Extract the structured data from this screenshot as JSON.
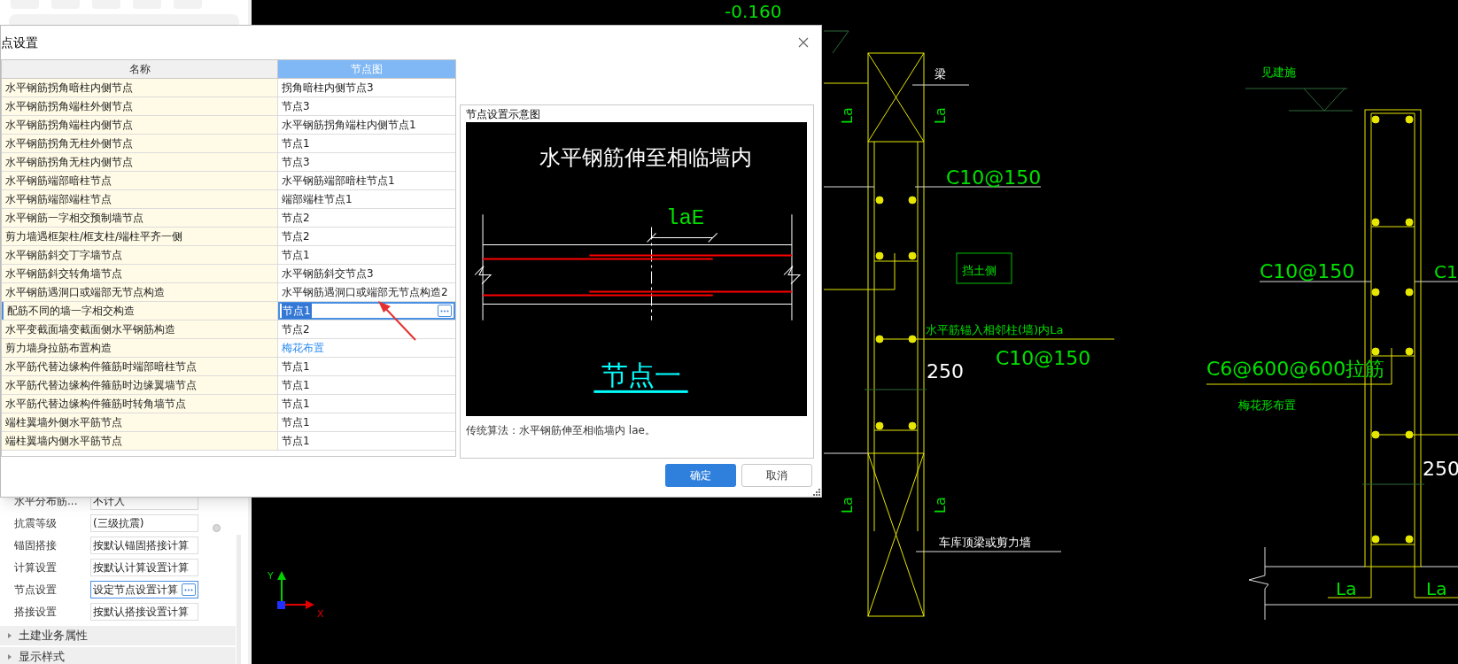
{
  "sidebar": {
    "properties": [
      {
        "label": "水平分布筋...",
        "value": "不计入",
        "kind": "text"
      },
      {
        "label": "抗震等级",
        "value": "(三级抗震)",
        "kind": "text"
      },
      {
        "label": "锚固搭接",
        "value": "按默认锚固搭接计算",
        "kind": "text"
      },
      {
        "label": "计算设置",
        "value": "按默认计算设置计算",
        "kind": "text"
      },
      {
        "label": "节点设置",
        "value": "设定节点设置计算",
        "kind": "ellipsis"
      },
      {
        "label": "搭接设置",
        "value": "按默认搭接设置计算",
        "kind": "text"
      }
    ],
    "groups": [
      {
        "label": "土建业务属性",
        "expanded": false
      },
      {
        "label": "显示样式",
        "expanded": false
      }
    ]
  },
  "dialog": {
    "title": "点设置",
    "columns": [
      "名称",
      "节点图"
    ],
    "rows": [
      {
        "name": "水平钢筋拐角暗柱内侧节点",
        "value": "拐角暗柱内侧节点3",
        "kind": "text",
        "selected": false
      },
      {
        "name": "水平钢筋拐角端柱外侧节点",
        "value": "节点3",
        "kind": "text",
        "selected": false
      },
      {
        "name": "水平钢筋拐角端柱内侧节点",
        "value": "水平钢筋拐角端柱内侧节点1",
        "kind": "text",
        "selected": false
      },
      {
        "name": "水平钢筋拐角无柱外侧节点",
        "value": "节点1",
        "kind": "text",
        "selected": false
      },
      {
        "name": "水平钢筋拐角无柱内侧节点",
        "value": "节点3",
        "kind": "text",
        "selected": false
      },
      {
        "name": "水平钢筋端部暗柱节点",
        "value": "水平钢筋端部暗柱节点1",
        "kind": "text",
        "selected": false
      },
      {
        "name": "水平钢筋端部端柱节点",
        "value": "端部端柱节点1",
        "kind": "text",
        "selected": false
      },
      {
        "name": "水平钢筋一字相交预制墙节点",
        "value": "节点2",
        "kind": "text",
        "selected": false
      },
      {
        "name": "剪力墙遇框架柱/框支柱/端柱平齐一侧",
        "value": "节点2",
        "kind": "text",
        "selected": false
      },
      {
        "name": "水平钢筋斜交丁字墙节点",
        "value": "节点1",
        "kind": "text",
        "selected": false
      },
      {
        "name": "水平钢筋斜交转角墙节点",
        "value": "水平钢筋斜交节点3",
        "kind": "text",
        "selected": false
      },
      {
        "name": "水平钢筋遇洞口或端部无节点构造",
        "value": "水平钢筋遇洞口或端部无节点构造2",
        "kind": "text",
        "selected": false
      },
      {
        "name": "配筋不同的墙一字相交构造",
        "value": "节点1",
        "kind": "text",
        "selected": true
      },
      {
        "name": "水平变截面墙变截面侧水平钢筋构造",
        "value": "节点2",
        "kind": "text",
        "selected": false
      },
      {
        "name": "剪力墙身拉筋布置构造",
        "value": "梅花布置",
        "kind": "link",
        "selected": false
      },
      {
        "name": "水平筋代替边缘构件箍筋时端部暗柱节点",
        "value": "节点1",
        "kind": "text",
        "selected": false
      },
      {
        "name": "水平筋代替边缘构件箍筋时边缘翼墙节点",
        "value": "节点1",
        "kind": "text",
        "selected": false
      },
      {
        "name": "水平筋代替边缘构件箍筋时转角墙节点",
        "value": "节点1",
        "kind": "text",
        "selected": false
      },
      {
        "name": "端柱翼墙外侧水平筋节点",
        "value": "节点1",
        "kind": "text",
        "selected": false
      },
      {
        "name": "端柱翼墙内侧水平筋节点",
        "value": "节点1",
        "kind": "text",
        "selected": false
      }
    ],
    "preview": {
      "title": "节点设置示意图",
      "heading": "水平钢筋伸至相临墙内",
      "dimension": "laE",
      "caption": "节点一",
      "description": "传统算法：水平钢筋伸至相临墙内 lae。"
    },
    "buttons": [
      {
        "label": "确定",
        "primary": true
      },
      {
        "label": "取消",
        "primary": false
      }
    ]
  },
  "cad": {
    "labels": [
      "-0.160",
      "梁",
      "La",
      "La",
      "C10@150",
      "挡土侧",
      "水平筋锚入相邻柱(墙)内La",
      "C10@150",
      "250",
      "La",
      "La",
      "车库顶梁或剪力墙",
      "见建施",
      "C10@150",
      "C1",
      "C6@600@600拉筋",
      "梅花形布置",
      "250",
      "La",
      "La"
    ],
    "axis": [
      "Y",
      "X"
    ]
  }
}
